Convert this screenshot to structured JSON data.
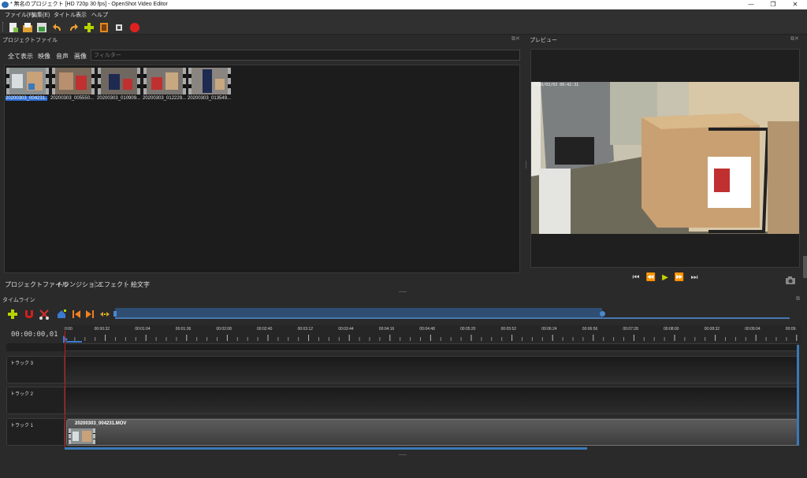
{
  "window": {
    "title": "* 無名のプロジェクト [HD 720p 30 fps] - OpenShot Video Editor",
    "minimize": "—",
    "maximize": "❐",
    "close": "✕"
  },
  "menu": [
    "ファイル(F)",
    "編集(E)",
    "タイトル",
    "表示",
    "ヘルプ"
  ],
  "toolbar": {
    "icons": [
      "new-project-icon",
      "open-project-icon",
      "save-project-icon",
      "undo-icon",
      "redo-icon",
      "import-files-icon",
      "choose-profile-icon",
      "fullscreen-icon",
      "export-video-icon"
    ]
  },
  "project_files": {
    "title": "プロジェクトファイル",
    "tabs": [
      "全て表示",
      "映像",
      "音声",
      "画像"
    ],
    "filter_placeholder": "フィルター",
    "files": [
      {
        "name": "20200303_004231..",
        "selected": true
      },
      {
        "name": "20200303_005550...",
        "selected": false
      },
      {
        "name": "20200303_010909...",
        "selected": false
      },
      {
        "name": "20200303_012229...",
        "selected": false
      },
      {
        "name": "20200303_013549...",
        "selected": false
      }
    ]
  },
  "bottom_tabs": [
    "プロジェクトファイル",
    "トランジション",
    "エフェクト",
    "絵文字"
  ],
  "preview": {
    "title": "プレビュー",
    "overlay_timestamp": "2020/03/03 00:42:31",
    "controls": [
      "jump-start-icon",
      "rewind-icon",
      "play-icon",
      "fast-forward-icon",
      "jump-end-icon"
    ]
  },
  "timeline": {
    "title": "タイムライン",
    "timecode": "00:00:00,01",
    "ruler_labels": [
      "0:00",
      "00:00:32",
      "00:01:04",
      "00:01:36",
      "00:02:08",
      "00:02:40",
      "00:03:12",
      "00:03:44",
      "00:04:16",
      "00:04:48",
      "00:05:20",
      "00:05:52",
      "00:06:24",
      "00:06:56",
      "00:07:28",
      "00:08:00",
      "00:08:32",
      "00:09:04",
      "00:09:"
    ],
    "tracks": [
      "トラック 3",
      "トラック 2",
      "トラック 1"
    ],
    "clip_name": "20200303_004231.MOV"
  },
  "colors": {
    "accent": "#2b6cd1",
    "playhead": "#c02020",
    "play_button": "#c8d400",
    "record": "#e02020"
  }
}
